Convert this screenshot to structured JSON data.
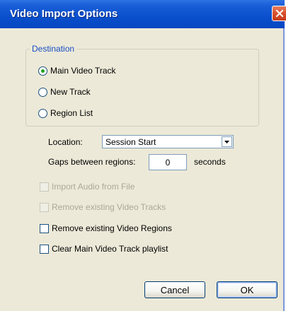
{
  "window": {
    "title": "Video Import Options",
    "close_icon": "close-icon"
  },
  "destination": {
    "label": "Destination",
    "options": [
      {
        "label": "Main Video Track",
        "checked": true
      },
      {
        "label": "New Track",
        "checked": false
      },
      {
        "label": "Region List",
        "checked": false
      }
    ]
  },
  "location": {
    "label": "Location:",
    "value": "Session Start"
  },
  "gaps": {
    "label": "Gaps between regions:",
    "value": "0",
    "unit": "seconds"
  },
  "options": [
    {
      "label": "Import Audio from File",
      "enabled": false,
      "checked": false
    },
    {
      "label": "Remove existing Video Tracks",
      "enabled": false,
      "checked": false
    },
    {
      "label": "Remove existing Video Regions",
      "enabled": true,
      "checked": false
    },
    {
      "label": "Clear Main Video Track playlist",
      "enabled": true,
      "checked": false
    }
  ],
  "buttons": {
    "cancel": "Cancel",
    "ok": "OK"
  },
  "colors": {
    "title_bar": "#0a4fcc",
    "group_label": "#1a4fc4",
    "dialog_bg": "#ece9d8",
    "radio_dot": "#21a121",
    "close_button": "#d8502c"
  }
}
